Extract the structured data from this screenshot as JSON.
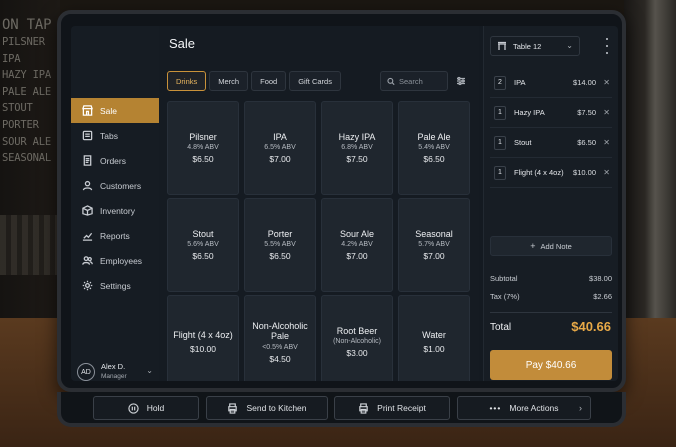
{
  "background": {
    "board_lines": [
      "ON TAP",
      "PILSNER",
      "IPA",
      "HAZY IPA",
      "PALE ALE",
      "STOUT",
      "PORTER",
      "SOUR ALE",
      "SEASONAL"
    ]
  },
  "colors": {
    "accent": "#b58332",
    "pay_button": "#c28c3a",
    "total": "#e8a947"
  },
  "main": {
    "title": "Sale",
    "tabs": [
      {
        "label": "Drinks",
        "active": true
      },
      {
        "label": "Merch",
        "active": false
      },
      {
        "label": "Food",
        "active": false
      },
      {
        "label": "Gift Cards",
        "active": false
      }
    ],
    "search_placeholder": "Search",
    "products": [
      {
        "name": "Pilsner",
        "sub": "4.8% ABV",
        "price": "$6.50"
      },
      {
        "name": "IPA",
        "sub": "6.5% ABV",
        "price": "$7.00"
      },
      {
        "name": "Hazy IPA",
        "sub": "6.8% ABV",
        "price": "$7.50"
      },
      {
        "name": "Pale Ale",
        "sub": "5.4% ABV",
        "price": "$6.50"
      },
      {
        "name": "Stout",
        "sub": "5.6% ABV",
        "price": "$6.50"
      },
      {
        "name": "Porter",
        "sub": "5.5% ABV",
        "price": "$6.50"
      },
      {
        "name": "Sour Ale",
        "sub": "4.2% ABV",
        "price": "$7.00"
      },
      {
        "name": "Seasonal",
        "sub": "5.7% ABV",
        "price": "$7.00"
      },
      {
        "name": "Flight (4 x 4oz)",
        "sub": "",
        "price": "$10.00"
      },
      {
        "name": "Non-Alcoholic Pale",
        "sub": "<0.5% ABV",
        "price": "$4.50"
      },
      {
        "name": "Root Beer",
        "sub": "(Non-Alcoholic)",
        "price": "$3.00"
      },
      {
        "name": "Water",
        "sub": "",
        "price": "$1.00"
      }
    ]
  },
  "sidebar": {
    "items": [
      {
        "label": "Sale",
        "icon": "store-icon",
        "active": true
      },
      {
        "label": "Tabs",
        "icon": "tabs-icon",
        "active": false
      },
      {
        "label": "Orders",
        "icon": "orders-icon",
        "active": false
      },
      {
        "label": "Customers",
        "icon": "customers-icon",
        "active": false
      },
      {
        "label": "Inventory",
        "icon": "inventory-icon",
        "active": false
      },
      {
        "label": "Reports",
        "icon": "reports-icon",
        "active": false
      },
      {
        "label": "Employees",
        "icon": "employees-icon",
        "active": false
      },
      {
        "label": "Settings",
        "icon": "settings-icon",
        "active": false
      }
    ],
    "user": {
      "initials": "AD",
      "name": "Alex D.",
      "role": "Manager"
    }
  },
  "order": {
    "table": "Table 12",
    "lines": [
      {
        "qty": "2",
        "item": "IPA",
        "price": "$14.00"
      },
      {
        "qty": "1",
        "item": "Hazy IPA",
        "price": "$7.50"
      },
      {
        "qty": "1",
        "item": "Stout",
        "price": "$6.50"
      },
      {
        "qty": "1",
        "item": "Flight (4 x 4oz)",
        "price": "$10.00"
      }
    ],
    "add_note": "Add Note",
    "subtotal_label": "Subtotal",
    "subtotal": "$38.00",
    "tax_label": "Tax (7%)",
    "tax": "$2.66",
    "total_label": "Total",
    "total": "$40.66",
    "pay_label": "Pay $40.66"
  },
  "actions": {
    "hold": "Hold",
    "send": "Send to Kitchen",
    "print": "Print Receipt",
    "more": "More Actions"
  }
}
